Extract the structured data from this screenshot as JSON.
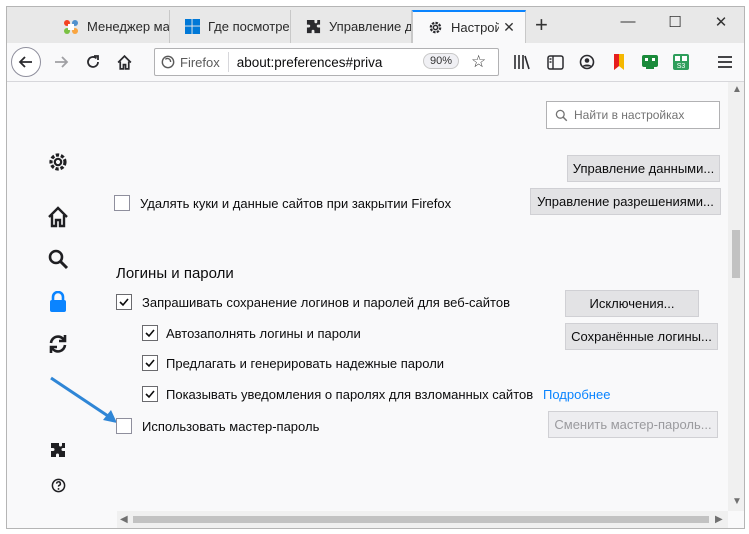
{
  "tabs": [
    {
      "label": "Менеджер мат",
      "icon": "joomla-icon"
    },
    {
      "label": "Где посмотре",
      "icon": "windows-icon"
    },
    {
      "label": "Управление д",
      "icon": "puzzle-icon"
    },
    {
      "label": "Настройки",
      "icon": "gear-icon",
      "active": true
    }
  ],
  "toolbar": {
    "identity_label": "Firefox",
    "url": "about:preferences#priva",
    "zoom": "90%"
  },
  "search": {
    "placeholder": "Найти в настройках"
  },
  "cookies": {
    "manage_data_button": "Управление данными...",
    "delete_on_close_label": "Удалять куки и данные сайтов при закрытии Firefox",
    "manage_permissions_button": "Управление разрешениями..."
  },
  "logins": {
    "heading": "Логины и пароли",
    "ask_save_label": "Запрашивать сохранение логинов и паролей для веб-сайтов",
    "exceptions_button": "Исключения...",
    "autofill_label": "Автозаполнять логины и пароли",
    "saved_logins_button": "Сохранённые логины...",
    "suggest_label": "Предлагать и генерировать надежные пароли",
    "breach_label": "Показывать уведомления о паролях для взломанных сайтов",
    "learn_more_link": "Подробнее",
    "master_label": "Использовать мастер-пароль",
    "change_master_button": "Сменить мастер-пароль..."
  },
  "colors": {
    "accent": "#0a84ff",
    "annotation_arrow": "#2f86d6",
    "lock": "#0a84ff"
  }
}
